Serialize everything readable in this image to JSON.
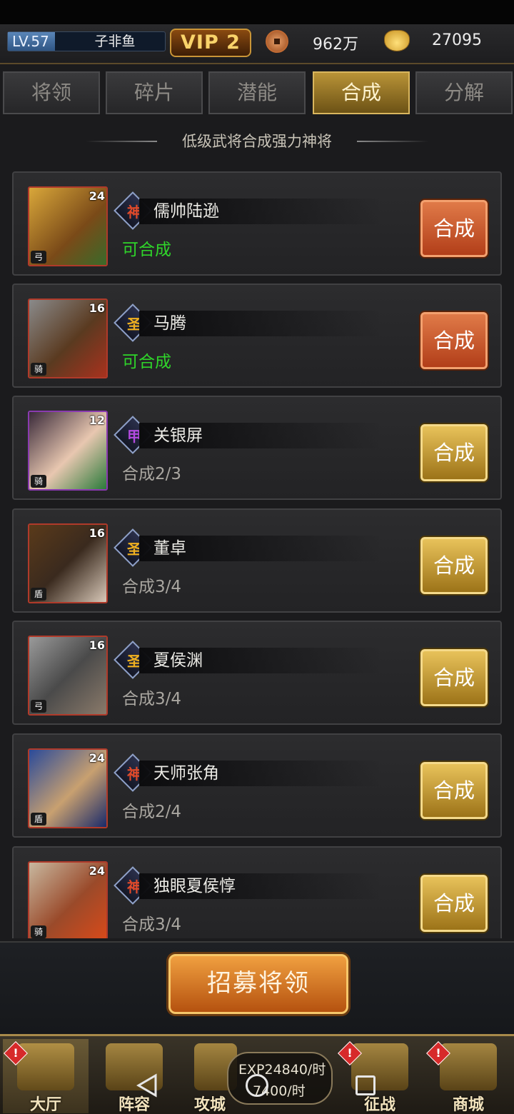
{
  "player": {
    "level_label": "LV.57",
    "name": "子非鱼",
    "vip": "VIP 2"
  },
  "resources": {
    "coins": "962万",
    "gold": "27095"
  },
  "tabs": [
    {
      "label": "将领",
      "active": false
    },
    {
      "label": "碎片",
      "active": false
    },
    {
      "label": "潜能",
      "active": false
    },
    {
      "label": "合成",
      "active": true
    },
    {
      "label": "分解",
      "active": false
    }
  ],
  "subtitle": "低级武将合成强力神将",
  "heroes": [
    {
      "name": "儒帅陆逊",
      "level": "24",
      "rank": "神",
      "status": "可合成",
      "ready": true,
      "button": "合成"
    },
    {
      "name": "马腾",
      "level": "16",
      "rank": "圣",
      "status": "可合成",
      "ready": true,
      "button": "合成"
    },
    {
      "name": "关银屏",
      "level": "12",
      "rank": "甲",
      "status": "合成2/3",
      "ready": false,
      "button": "合成"
    },
    {
      "name": "董卓",
      "level": "16",
      "rank": "圣",
      "status": "合成3/4",
      "ready": false,
      "button": "合成"
    },
    {
      "name": "夏侯渊",
      "level": "16",
      "rank": "圣",
      "status": "合成3/4",
      "ready": false,
      "button": "合成"
    },
    {
      "name": "天师张角",
      "level": "24",
      "rank": "神",
      "status": "合成2/4",
      "ready": false,
      "button": "合成"
    },
    {
      "name": "独眼夏侯惇",
      "level": "24",
      "rank": "神",
      "status": "合成3/4",
      "ready": false,
      "button": "合成"
    }
  ],
  "recruit_button": "招募将领",
  "nav": [
    {
      "label": "大厅",
      "alert": true
    },
    {
      "label": "阵容",
      "alert": false
    },
    {
      "label": "攻城",
      "alert": false
    },
    {
      "label": "征战",
      "alert": true
    },
    {
      "label": "商城",
      "alert": true
    }
  ],
  "exp": {
    "line1": "EXP24840/时",
    "line2": "7400/时"
  },
  "colors": {
    "ready": "#2fd52a",
    "accent_gold": "#d9b65e",
    "button_red": "#c2481d"
  }
}
